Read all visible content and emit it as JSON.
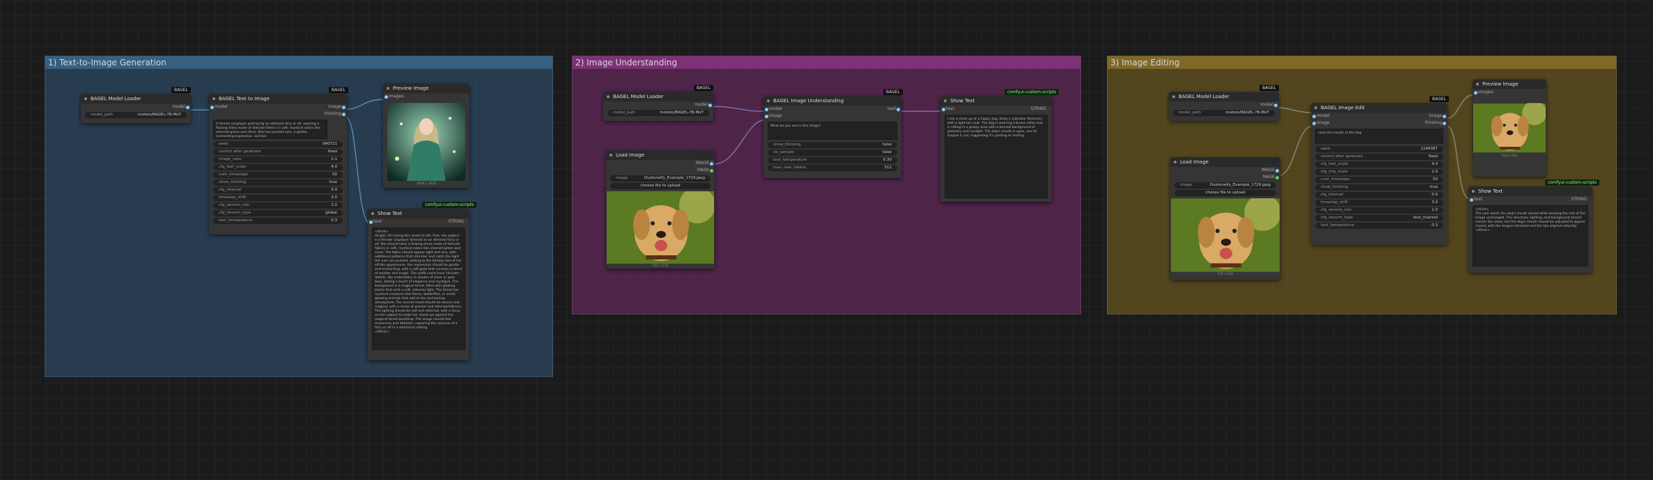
{
  "groups": {
    "g1": {
      "title": "1) Text-to-Image Generation"
    },
    "g2": {
      "title": "2) Image Understanding"
    },
    "g3": {
      "title": "3) Image Editing"
    }
  },
  "n1_loader": {
    "title": "BAGEL Model Loader",
    "badge": "BAGEL",
    "out": "model",
    "widget_label": "model_path",
    "widget_value": "models/BAGEL-7B-MoT"
  },
  "n1_t2i": {
    "title": "BAGEL Text to Image",
    "badge": "BAGEL",
    "in": "model",
    "out1": "image",
    "out2": "thinking",
    "prompt": "A female cosplayer portraying an ethereal fairy or elf, wearing a flowing dress made of delicate fabrics in soft, mystical colors like emerald green and silver. She has pointed ears, a gentle, enchanting expression, and her",
    "widgets": [
      {
        "label": "seed",
        "value": "940721"
      },
      {
        "label": "control after generate",
        "value": "fixed"
      },
      {
        "label": "image_ratio",
        "value": "1:1"
      },
      {
        "label": "cfg_text_scale",
        "value": "4.0"
      },
      {
        "label": "num_timesteps",
        "value": "50"
      },
      {
        "label": "show_thinking",
        "value": "true"
      },
      {
        "label": "cfg_interval",
        "value": "0.4"
      },
      {
        "label": "timestep_shift",
        "value": "3.0"
      },
      {
        "label": "cfg_renorm_min",
        "value": "1.0"
      },
      {
        "label": "cfg_renorm_type",
        "value": "global"
      },
      {
        "label": "text_temperature",
        "value": "0.3"
      }
    ]
  },
  "n1_preview": {
    "title": "Preview Image",
    "in": "images",
    "caption": "1024 x 1024"
  },
  "n1_show": {
    "title": "Show Text",
    "badge": "comfyui-custom-scripts",
    "in": "text",
    "out": "STRING",
    "text": "<think>\nAlright, let's bring this vision to life. First, the subject is a female cosplayer dressed as an ethereal fairy or elf. She should have a flowing dress made of delicate fabrics in soft, mystical colors like emerald green and silver. The fabric should appear light and airy, with additional patterns that shimmer and catch the light. Her ears are pointed, adding to the fantasy feel of her elf-like appearance. Her expression should be gentle and enchanting, with a soft gaze that conveys a sense of wonder and magic. The outfit could have intricate details, like embroidery in shades of silver or pale blue, adding a touch of elegance and mystique. The background is a magical forest, filled with glowing plants that emit a soft, ethereal light. The forest has mystical creatures like fairies, butterflies, or small, glowing animals that add to the enchanting atmosphere. The overall mood should be serene and magical, with a sense of wonder and otherworldliness. The lighting should be soft and ethereal, with a focus on the subject to make her stand out against the magical forest backdrop. The image should feel immersive and detailed, capturing the essence of a fairy or elf in a whimsical setting.\n</think>"
  },
  "n2_loader": {
    "title": "BAGEL Model Loader",
    "badge": "BAGEL",
    "out": "model",
    "widget_label": "model_path",
    "widget_value": "models/BAGEL-7B-MoT"
  },
  "n2_load": {
    "title": "Load Image",
    "out1": "IMAGE",
    "out2": "MASK",
    "widget_label": "image",
    "widget_value": "Duotoneify_Example_1729.jpeg",
    "upload": "choose file to upload",
    "caption": "512 x 512"
  },
  "n2_und": {
    "title": "BAGEL Image Understanding",
    "badge": "BAGEL",
    "in1": "model",
    "in2": "image",
    "out": "text",
    "prompt": "What do you see in this image?",
    "widgets": [
      {
        "label": "show_thinking",
        "value": "false"
      },
      {
        "label": "do_sample",
        "value": "false"
      },
      {
        "label": "text_temperature",
        "value": "0.30"
      },
      {
        "label": "max_new_tokens",
        "value": "512"
      }
    ]
  },
  "n2_show": {
    "title": "Show Text",
    "badge": "comfyui-custom-scripts",
    "in": "text",
    "out": "STRING",
    "text": "I see a close-up of a happy dog, likely a Labrador Retriever, with a light tan coat. The dog is wearing a brown collar and is sitting in a grassy area with a blurred background of greenery and sunlight. The dog's mouth is open, and its tongue is out, suggesting it's panting or smiling."
  },
  "n3_loader": {
    "title": "BAGEL Model Loader",
    "badge": "BAGEL",
    "out": "model",
    "widget_label": "model_path",
    "widget_value": "models/BAGEL-7B-MoT"
  },
  "n3_load": {
    "title": "Load Image",
    "out1": "IMAGE",
    "out2": "MASK",
    "widget_label": "image",
    "widget_value": "Duotoneify_Example_1729.jpeg",
    "upload": "choose file to upload",
    "caption": "512 x 512"
  },
  "n3_edit": {
    "title": "BAGEL Image Edit",
    "badge": "BAGEL",
    "in1": "model",
    "in2": "image",
    "out1": "image",
    "out2": "thinking",
    "prompt": "close the mouth of the dog",
    "widgets": [
      {
        "label": "seed",
        "value": "1149387"
      },
      {
        "label": "control after generate",
        "value": "fixed"
      },
      {
        "label": "cfg_text_scale",
        "value": "4.0"
      },
      {
        "label": "cfg_img_scale",
        "value": "2.0"
      },
      {
        "label": "num_timesteps",
        "value": "50"
      },
      {
        "label": "show_thinking",
        "value": "true"
      },
      {
        "label": "cfg_interval",
        "value": "0.0"
      },
      {
        "label": "timestep_shift",
        "value": "3.0"
      },
      {
        "label": "cfg_renorm_min",
        "value": "1.0"
      },
      {
        "label": "cfg_renorm_type",
        "value": "text_channel"
      },
      {
        "label": "text_temperature",
        "value": "0.3"
      }
    ]
  },
  "n3_preview": {
    "title": "Preview Image",
    "in": "images",
    "caption": "512 x 512"
  },
  "n3_show": {
    "title": "Show Text",
    "badge": "comfyui-custom-scripts",
    "in": "text",
    "out": "STRING",
    "text": "<think>\nThe user wants the dog's mouth closed while keeping the rest of the image unchanged. The structure, lighting, and background should remain the same, but the dog's mouth should be adjusted to appear closed, with the tongue retracted and the lips aligned naturally.\n</think>"
  },
  "colors": {
    "wire": "#8cf",
    "g1": "#32587a",
    "g2": "#782c70",
    "g3": "#786222"
  }
}
